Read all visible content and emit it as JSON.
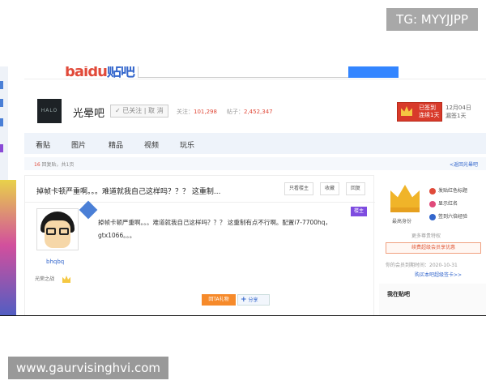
{
  "watermark_top": "TG: MYYJJPP",
  "watermark_bottom": "www.gaurvisinghvi.com",
  "topnav": {
    "logo_fragment_red": "baidu",
    "logo_fragment_blue": "贴吧"
  },
  "forum": {
    "logo_text": "HALO",
    "name": "光晕吧",
    "follow_label": "✓ 已关注 | 取 消",
    "followers_label": "关注：",
    "followers_value": "101,298",
    "posts_label": "帖子：",
    "posts_value": "2,452,347",
    "checkin_line1": "已签到",
    "checkin_line2": "连续1天",
    "checkin_date_line1": "12月04日",
    "checkin_date_line2": "漏签1天"
  },
  "tabs": [
    "看贴",
    "图片",
    "精品",
    "视频",
    "玩乐"
  ],
  "crumb": {
    "replies": "16",
    "replies_suffix": " 回复贴，共1页",
    "back_link": "<返回光晕吧"
  },
  "post": {
    "title": "掉帧卡顿严重啊。。。难道就我自己这样吗？？？ 这重制...",
    "btn_only_op": "只看楼主",
    "btn_collect": "收藏",
    "btn_reply": "回复",
    "op_badge": "楼主",
    "author_name": "bhqbq",
    "author_level": "光荣之战",
    "body": "掉帧卡顿严重啊。。。难道就我自己这样吗？？？ 这重制有点不行啊。配置i7-7700hq，gtx1066。。。",
    "btn_orange": "回TA礼物",
    "btn_share": "分享"
  },
  "sidebar": {
    "crown_caption": "最高身份",
    "links": [
      {
        "label": "发贴红色标题",
        "color": "#e04a3a"
      },
      {
        "label": "显示红名",
        "color": "#e04a7a"
      },
      {
        "label": "签到六倍经验",
        "color": "#3366cc"
      }
    ],
    "more_label": "更多尊贵特权",
    "renew_label": "续费超级会员享优惠",
    "expire_text": "你的会员到期时间：2020-10-31",
    "buy_link": "购买本吧超级签卡>>",
    "section_title": "我在贴吧"
  }
}
